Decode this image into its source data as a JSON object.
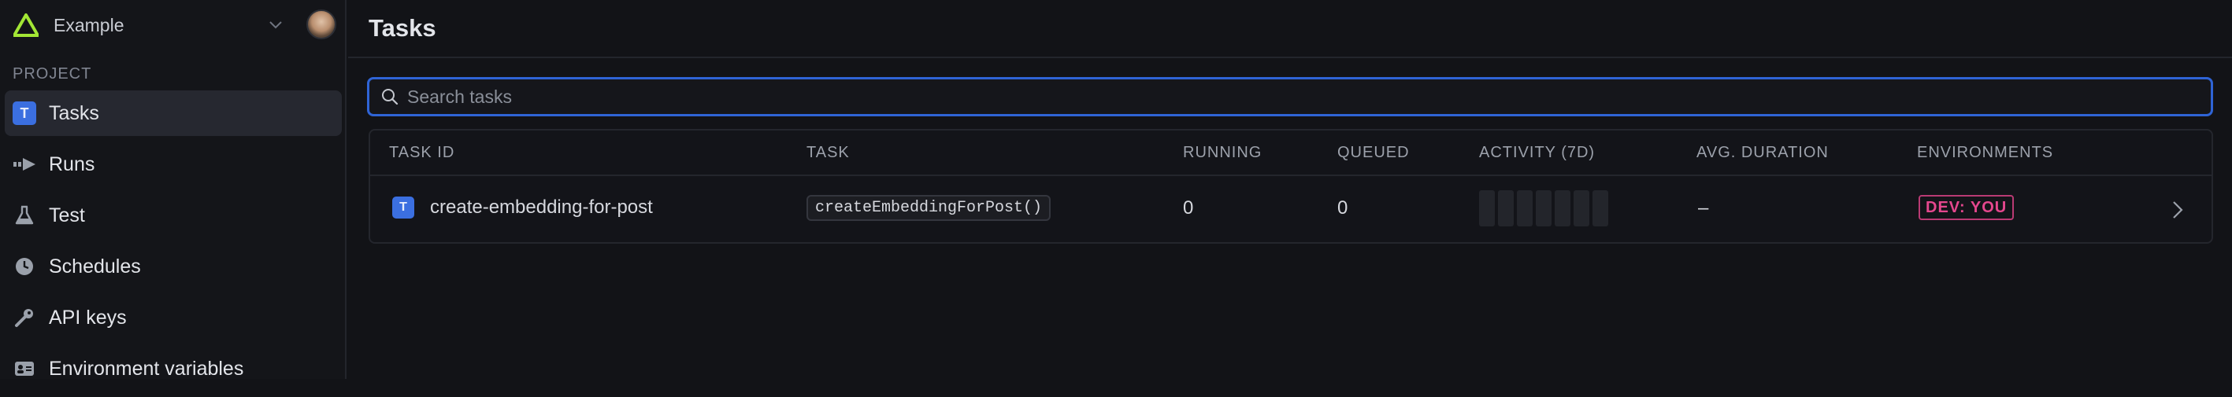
{
  "org": {
    "name": "Example"
  },
  "sidebar": {
    "section_title": "PROJECT",
    "items": [
      {
        "label": "Tasks",
        "icon": "task-badge-icon",
        "badge": "T",
        "active": true
      },
      {
        "label": "Runs",
        "icon": "runs-icon"
      },
      {
        "label": "Test",
        "icon": "beaker-icon"
      },
      {
        "label": "Schedules",
        "icon": "clock-icon"
      },
      {
        "label": "API keys",
        "icon": "key-icon"
      },
      {
        "label": "Environment variables",
        "icon": "id-card-icon"
      }
    ]
  },
  "page": {
    "title": "Tasks"
  },
  "search": {
    "placeholder": "Search tasks",
    "value": ""
  },
  "table": {
    "headers": {
      "task_id": "TASK ID",
      "task": "TASK",
      "running": "RUNNING",
      "queued": "QUEUED",
      "activity": "ACTIVITY (7D)",
      "avg_duration": "AVG. DURATION",
      "environments": "ENVIRONMENTS"
    },
    "rows": [
      {
        "badge": "T",
        "task_id": "create-embedding-for-post",
        "task": "createEmbeddingForPost()",
        "running": "0",
        "queued": "0",
        "activity_days": 7,
        "avg_duration": "–",
        "environment": "DEV: YOU"
      }
    ]
  },
  "colors": {
    "accent_blue": "#2f64d6",
    "task_badge": "#3b6fe0",
    "env_pink": "#e5478e",
    "logo_green": "#a3e635"
  }
}
